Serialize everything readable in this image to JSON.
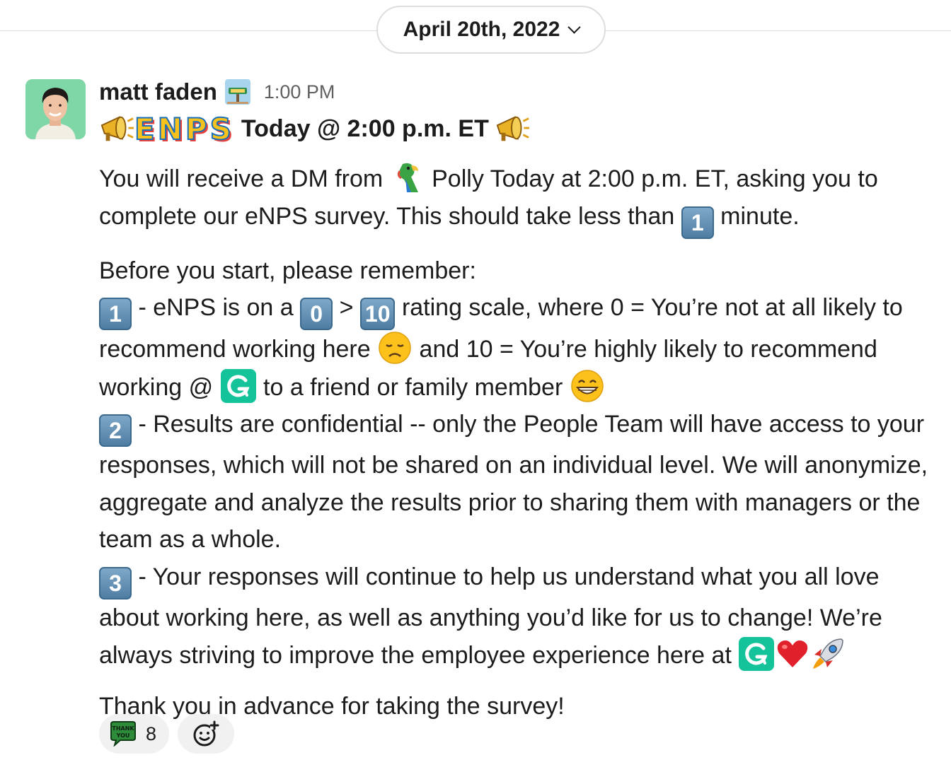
{
  "date_divider": {
    "label": "April 20th, 2022"
  },
  "message": {
    "author": "matt faden",
    "timestamp": "1:00 PM",
    "title_prefix_icon": "megaphone-icon",
    "title_enps": [
      "E",
      "N",
      "P",
      "S"
    ],
    "title": "Today @ 2:00 p.m. ET",
    "para1": {
      "t1": "You will receive a DM from",
      "t2": "Polly Today at 2:00 p.m. ET, asking you to",
      "t3": "complete our eNPS survey. This should take less than",
      "t4": "minute."
    },
    "keycaps": {
      "one": "1",
      "zero": "0",
      "ten": "10",
      "two": "2",
      "three": "3"
    },
    "para2": {
      "intro": "Before you start, please remember:",
      "p1_a": "- eNPS is on a",
      "p1_gt": ">",
      "p1_b": "rating scale, where 0 = You’re not at all likely to",
      "p1_c": "recommend working here",
      "p1_d": "and 10 = You’re highly likely to recommend",
      "p1_e": "working @",
      "p1_f": "to a friend or family member",
      "p2_a": "- Results are confidential -- only the People Team will have access to your",
      "p2_b": "responses, which will not be shared on an individual level. We will anonymize,",
      "p2_c": "aggregate and analyze the results prior to sharing them with managers or the",
      "p2_d": "team as a whole.",
      "p3_a": "- Your responses will continue to help us understand what you all love",
      "p3_b": "about working here, as well as anything you’d like for us to change! We’re",
      "p3_c": "always striving to improve the employee experience here at"
    },
    "closing": "Thank you in advance for taking the survey!"
  },
  "reactions": [
    {
      "icon": "thank-you-icon",
      "count": "8"
    }
  ],
  "colors": {
    "accent_green": "#15c39a",
    "keycap_blue": "#5a89ad",
    "muted": "#616061"
  }
}
